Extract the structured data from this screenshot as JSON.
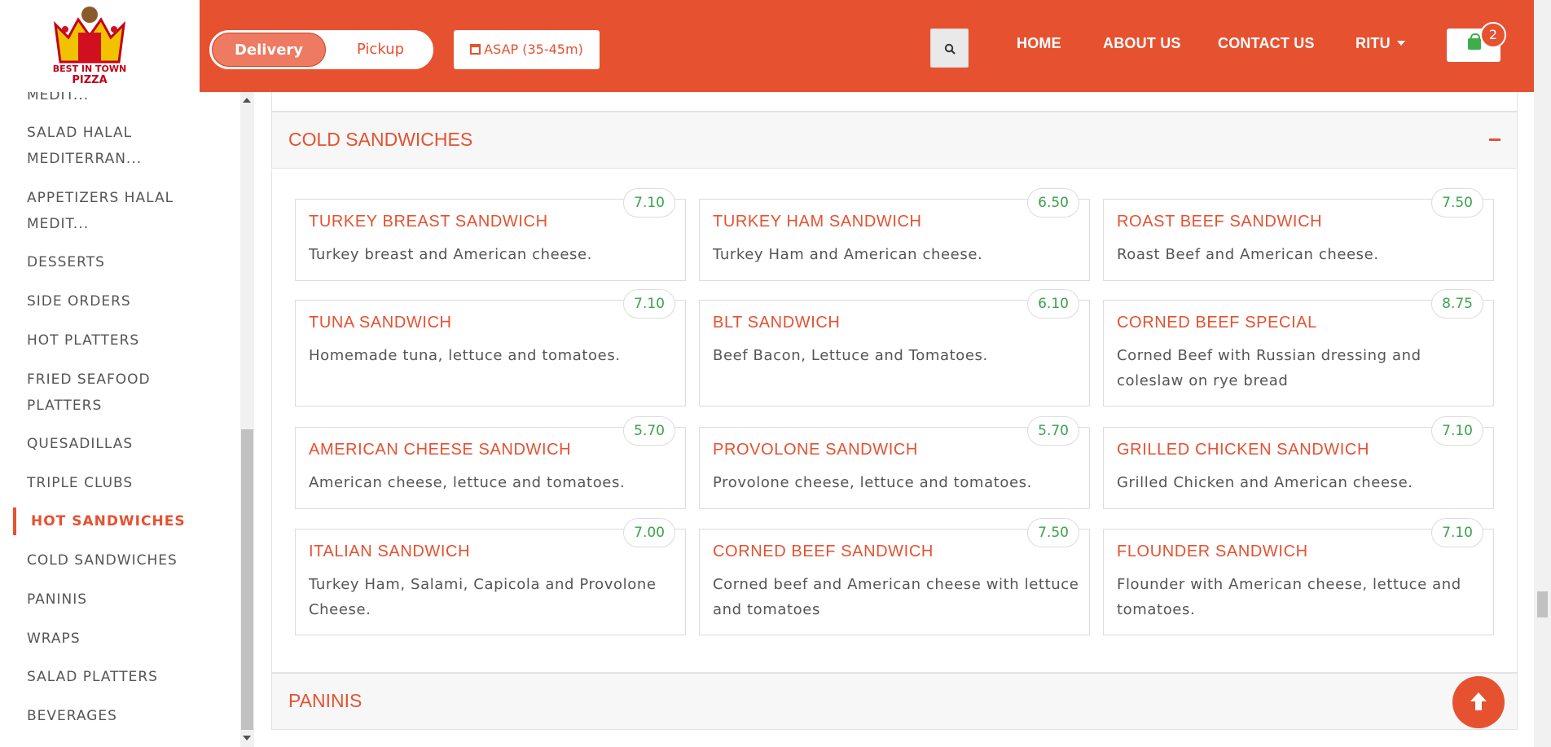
{
  "header": {
    "logo": {
      "text_top": "BEST IN TOWN",
      "text_bottom": "PIZZA"
    },
    "order_type": {
      "delivery": "Delivery",
      "pickup": "Pickup",
      "selected": "Delivery"
    },
    "asap_label": "ASAP (35-45m)",
    "nav": {
      "home": "HOME",
      "about": "ABOUT US",
      "contact": "CONTACT US",
      "user": "RITU"
    },
    "cart_count": "2",
    "accent_color": "#e65130"
  },
  "sidebar": {
    "items": [
      {
        "label": "MEDIT..."
      },
      {
        "label": "SALAD HALAL MEDITERRAN..."
      },
      {
        "label": "APPETIZERS HALAL MEDIT..."
      },
      {
        "label": "DESSERTS"
      },
      {
        "label": "SIDE ORDERS"
      },
      {
        "label": "HOT PLATTERS"
      },
      {
        "label": "FRIED SEAFOOD PLATTERS"
      },
      {
        "label": "QUESADILLAS"
      },
      {
        "label": "TRIPLE CLUBS"
      },
      {
        "label": "HOT SANDWICHES"
      },
      {
        "label": "COLD SANDWICHES"
      },
      {
        "label": "PANINIS"
      },
      {
        "label": "WRAPS"
      },
      {
        "label": "SALAD PLATTERS"
      },
      {
        "label": "BEVERAGES"
      }
    ],
    "active": "HOT SANDWICHES"
  },
  "sections": {
    "cold": {
      "title": "COLD SANDWICHES",
      "items": [
        {
          "name": "TURKEY BREAST SANDWICH",
          "desc": "Turkey breast and American cheese.",
          "price": "7.10"
        },
        {
          "name": "TURKEY HAM SANDWICH",
          "desc": "Turkey Ham and American cheese.",
          "price": "6.50"
        },
        {
          "name": "ROAST BEEF SANDWICH",
          "desc": "Roast Beef and American cheese.",
          "price": "7.50"
        },
        {
          "name": "TUNA SANDWICH",
          "desc": "Homemade tuna, lettuce and tomatoes.",
          "price": "7.10"
        },
        {
          "name": "BLT SANDWICH",
          "desc": "Beef Bacon, Lettuce and Tomatoes.",
          "price": "6.10"
        },
        {
          "name": "CORNED BEEF SPECIAL",
          "desc": "Corned Beef with Russian dressing and coleslaw on rye bread",
          "price": "8.75"
        },
        {
          "name": "AMERICAN CHEESE SANDWICH",
          "desc": "American cheese, lettuce and tomatoes.",
          "price": "5.70"
        },
        {
          "name": "PROVOLONE SANDWICH",
          "desc": "Provolone cheese, lettuce and tomatoes.",
          "price": "5.70"
        },
        {
          "name": "GRILLED CHICKEN SANDWICH",
          "desc": "Grilled Chicken and American cheese.",
          "price": "7.10"
        },
        {
          "name": "ITALIAN SANDWICH",
          "desc": "Turkey Ham, Salami, Capicola and Provolone Cheese.",
          "price": "7.00"
        },
        {
          "name": "CORNED BEEF SANDWICH",
          "desc": "Corned beef and American cheese with lettuce and tomatoes",
          "price": "7.50"
        },
        {
          "name": "FLOUNDER SANDWICH",
          "desc": "Flounder with American cheese, lettuce and tomatoes.",
          "price": "7.10"
        }
      ]
    },
    "paninis": {
      "title": "PANINIS"
    }
  }
}
